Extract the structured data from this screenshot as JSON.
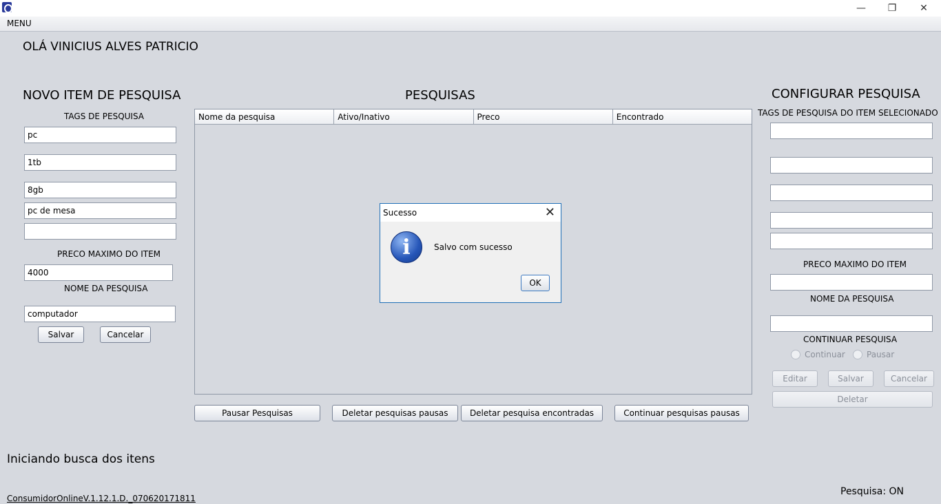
{
  "window": {
    "minimize_icon": "minimize-icon",
    "restore_icon": "restore-icon",
    "close_icon": "close-icon"
  },
  "menu": {
    "label": "MENU"
  },
  "greeting": "OLÁ  VINICIUS ALVES PATRICIO",
  "new_item": {
    "title": "NOVO ITEM DE PESQUISA",
    "tags_label": "TAGS DE PESQUISA",
    "tags": [
      "pc",
      "1tb",
      "8gb",
      "pc de mesa",
      ""
    ],
    "price_label": "PRECO MAXIMO DO ITEM",
    "price_value": "4000",
    "name_label": "NOME DA PESQUISA",
    "name_value": "computador",
    "save_button": "Salvar",
    "cancel_button": "Cancelar"
  },
  "searches": {
    "title": "PESQUISAS",
    "columns": [
      "Nome da pesquisa",
      "Ativo/Inativo",
      "Preco",
      "Encontrado"
    ],
    "rows": [],
    "buttons": {
      "pause": "Pausar Pesquisas",
      "delete_paused": "Deletar pesquisas pausas",
      "delete_found": "Deletar pesquisa encontradas",
      "continue_paused": "Continuar pesquisas pausas"
    }
  },
  "config": {
    "title": "CONFIGURAR PESQUISA",
    "tags_label": "TAGS DE PESQUISA DO ITEM SELECIONADO",
    "tags": [
      "",
      "",
      "",
      "",
      ""
    ],
    "price_label": "PRECO MAXIMO DO ITEM",
    "price_value": "",
    "name_label": "NOME DA PESQUISA",
    "name_value": "",
    "continue_label": "CONTINUAR PESQUISA",
    "radio_continue": "Continuar",
    "radio_pause": "Pausar",
    "edit_button": "Editar",
    "save_button": "Salvar",
    "cancel_button": "Cancelar",
    "delete_button": "Deletar"
  },
  "dialog": {
    "title": "Sucesso",
    "message": "Salvo com sucesso",
    "ok_button": "OK",
    "icon": "info-icon"
  },
  "status": {
    "message": "Iniciando busca dos itens",
    "version": "ConsumidorOnlineV.1.12.1.D._070620171811",
    "search_state": "Pesquisa: ON"
  },
  "colors": {
    "background": "#d6d9df",
    "dialog_border": "#1f6fb7",
    "info_icon": "#2656b8"
  }
}
